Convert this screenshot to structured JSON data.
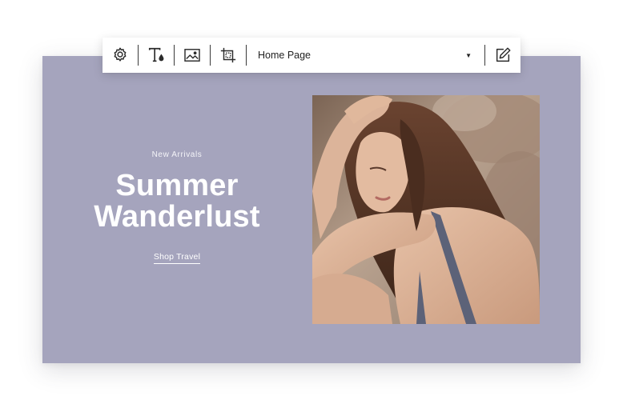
{
  "toolbar": {
    "page_select": {
      "value": "Home Page"
    },
    "icons": [
      "gear-icon",
      "text-color-icon",
      "image-icon",
      "crop-icon",
      "caret-down-icon",
      "edit-icon"
    ]
  },
  "hero": {
    "eyebrow": "New Arrivals",
    "headline": "Summer\nWanderlust",
    "cta_label": "Shop Travel",
    "background_color": "#a5a4bd",
    "text_color": "#ffffff"
  },
  "colors": {
    "toolbar_bg": "#ffffff",
    "icon_color": "#2b2b2b"
  }
}
